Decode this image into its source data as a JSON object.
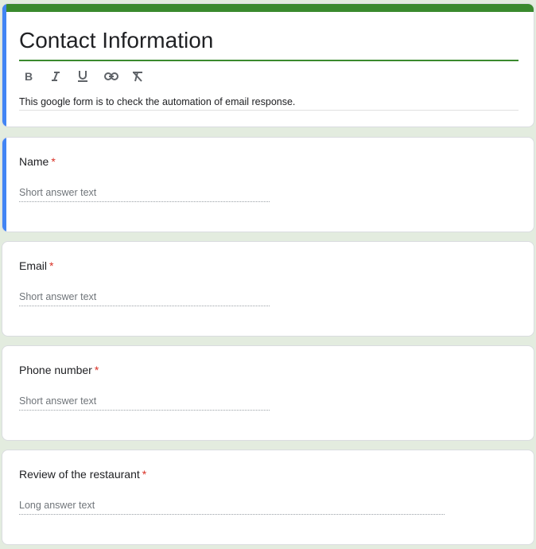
{
  "form": {
    "title": "Contact Information",
    "description": "This google form is to check the automation of email response.",
    "toolbar": [
      "bold-icon",
      "italic-icon",
      "underline-icon",
      "link-icon",
      "clear-format-icon"
    ]
  },
  "questions": [
    {
      "label": "Name",
      "required_mark": "*",
      "placeholder": "Short answer text"
    },
    {
      "label": "Email",
      "required_mark": "*",
      "placeholder": "Short answer text"
    },
    {
      "label": "Phone number",
      "required_mark": "*",
      "placeholder": "Short answer text"
    },
    {
      "label": "Review of the restaurant",
      "required_mark": "*",
      "placeholder": "Long answer text"
    }
  ],
  "colors": {
    "theme": "#3a8a2e",
    "accent": "#4285f4",
    "background": "#e3ecdf",
    "required": "#d93025"
  }
}
